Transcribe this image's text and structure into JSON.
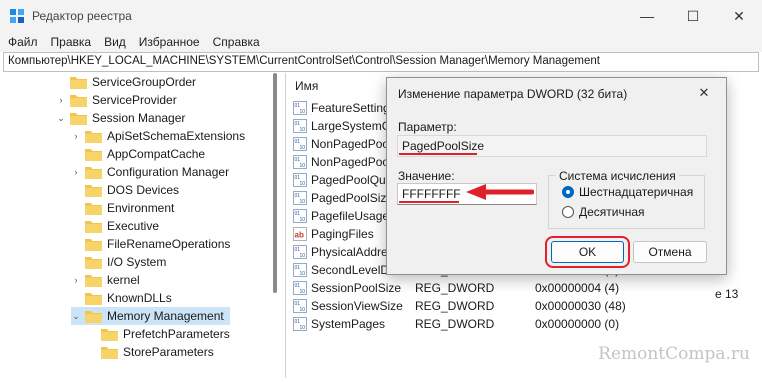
{
  "window": {
    "title": "Редактор реестра",
    "controls": {
      "minimize": "—",
      "maximize": "☐",
      "close": "✕"
    }
  },
  "menu": [
    "Файл",
    "Правка",
    "Вид",
    "Избранное",
    "Справка"
  ],
  "address": "Компьютер\\HKEY_LOCAL_MACHINE\\SYSTEM\\CurrentControlSet\\Control\\Session Manager\\Memory Management",
  "tree": {
    "items": [
      {
        "label": "ServiceGroupOrder",
        "level": 0,
        "expandable": false,
        "expanded": false,
        "selected": false
      },
      {
        "label": "ServiceProvider",
        "level": 0,
        "expandable": true,
        "expanded": false,
        "selected": false
      },
      {
        "label": "Session Manager",
        "level": 0,
        "expandable": true,
        "expanded": true,
        "selected": false
      },
      {
        "label": "ApiSetSchemaExtensions",
        "level": 1,
        "expandable": true,
        "expanded": false,
        "selected": false
      },
      {
        "label": "AppCompatCache",
        "level": 1,
        "expandable": false,
        "expanded": false,
        "selected": false
      },
      {
        "label": "Configuration Manager",
        "level": 1,
        "expandable": true,
        "expanded": false,
        "selected": false
      },
      {
        "label": "DOS Devices",
        "level": 1,
        "expandable": false,
        "expanded": false,
        "selected": false
      },
      {
        "label": "Environment",
        "level": 1,
        "expandable": false,
        "expanded": false,
        "selected": false
      },
      {
        "label": "Executive",
        "level": 1,
        "expandable": false,
        "expanded": false,
        "selected": false
      },
      {
        "label": "FileRenameOperations",
        "level": 1,
        "expandable": false,
        "expanded": false,
        "selected": false
      },
      {
        "label": "I/O System",
        "level": 1,
        "expandable": false,
        "expanded": false,
        "selected": false
      },
      {
        "label": "kernel",
        "level": 1,
        "expandable": true,
        "expanded": false,
        "selected": false
      },
      {
        "label": "KnownDLLs",
        "level": 1,
        "expandable": false,
        "expanded": false,
        "selected": false
      },
      {
        "label": "Memory Management",
        "level": 1,
        "expandable": true,
        "expanded": true,
        "selected": true
      },
      {
        "label": "PrefetchParameters",
        "level": 2,
        "expandable": false,
        "expanded": false,
        "selected": false
      },
      {
        "label": "StoreParameters",
        "level": 2,
        "expandable": false,
        "expanded": false,
        "selected": false
      }
    ]
  },
  "list": {
    "header_name": "Имя",
    "rows": [
      {
        "icon": "dword-icon",
        "name": "FeatureSettings",
        "type": "",
        "data": ""
      },
      {
        "icon": "dword-icon",
        "name": "LargeSystemCa",
        "type": "",
        "data": ""
      },
      {
        "icon": "dword-icon",
        "name": "NonPagedPoo",
        "type": "",
        "data": ""
      },
      {
        "icon": "dword-icon",
        "name": "NonPagedPoo",
        "type": "",
        "data": ""
      },
      {
        "icon": "dword-icon",
        "name": "PagedPoolQuo",
        "type": "",
        "data": ""
      },
      {
        "icon": "dword-icon",
        "name": "PagedPoolSize",
        "type": "",
        "data": ""
      },
      {
        "icon": "dword-icon",
        "name": "PagefileUsage",
        "type": "",
        "data": ""
      },
      {
        "icon": "string-icon",
        "name": "PagingFiles",
        "type": "",
        "data": ""
      },
      {
        "icon": "dword-icon",
        "name": "PhysicalAddres",
        "type": "",
        "data": ""
      },
      {
        "icon": "dword-icon",
        "name": "SecondLevelDat...",
        "type": "REG_DWORD",
        "data": "0x00000000 (0)"
      },
      {
        "icon": "dword-icon",
        "name": "SessionPoolSize",
        "type": "REG_DWORD",
        "data": "0x00000004 (4)"
      },
      {
        "icon": "dword-icon",
        "name": "SessionViewSize",
        "type": "REG_DWORD",
        "data": "0x00000030 (48)"
      },
      {
        "icon": "dword-icon",
        "name": "SystemPages",
        "type": "REG_DWORD",
        "data": "0x00000000 (0)"
      }
    ],
    "partial_value": "е 13"
  },
  "dialog": {
    "title": "Изменение параметра DWORD (32 бита)",
    "close": "✕",
    "param_label": "Параметр:",
    "param_value": "PagedPoolSize",
    "value_label": "Значение:",
    "value": "FFFFFFFF",
    "base_label": "Система исчисления",
    "radio_hex": "Шестнадцатеричная",
    "radio_dec": "Десятичная",
    "base_selected": "hex",
    "ok": "OK",
    "cancel": "Отмена"
  },
  "colors": {
    "highlight": "#e0202a",
    "accent": "#0067c0",
    "selection": "#cce4f7",
    "folder": "#f2c64e"
  },
  "watermark": "RemontCompa.ru"
}
